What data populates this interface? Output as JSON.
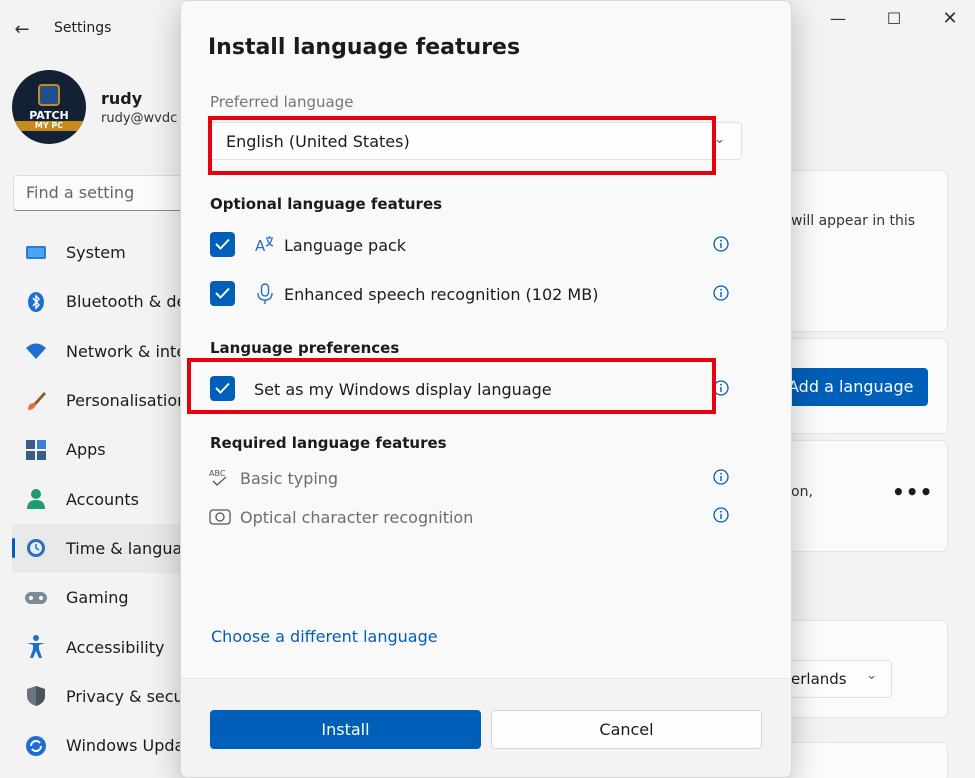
{
  "window": {
    "title": "Settings",
    "back_glyph": "←",
    "minimize_glyph": "—",
    "maximize_glyph": "☐",
    "close_glyph": "✕"
  },
  "user": {
    "name": "rudy",
    "email": "rudy@wvdc",
    "avatar_text_top": "PATCH",
    "avatar_text_bottom": "MY PC"
  },
  "search": {
    "placeholder": "Find a setting"
  },
  "sidebar": {
    "items": [
      {
        "label": "System",
        "icon": "monitor-icon"
      },
      {
        "label": "Bluetooth & de",
        "icon": "bluetooth-icon"
      },
      {
        "label": "Network & inte",
        "icon": "wifi-icon"
      },
      {
        "label": "Personalisation",
        "icon": "brush-icon"
      },
      {
        "label": "Apps",
        "icon": "apps-icon"
      },
      {
        "label": "Accounts",
        "icon": "person-icon"
      },
      {
        "label": "Time & langua",
        "icon": "clock-globe-icon",
        "active": true
      },
      {
        "label": "Gaming",
        "icon": "gamepad-icon"
      },
      {
        "label": "Accessibility",
        "icon": "accessibility-icon"
      },
      {
        "label": "Privacy & secu",
        "icon": "shield-icon"
      },
      {
        "label": "Windows Upda",
        "icon": "update-icon"
      }
    ]
  },
  "background": {
    "info_text": "will appear in this",
    "add_language_label": "Add a language",
    "partial_text": "on,",
    "more_glyph": "•••",
    "region_value": "erlands",
    "region_chevron": "⌄"
  },
  "dialog": {
    "title": "Install language features",
    "preferred_label": "Preferred language",
    "preferred_value": "English (United States)",
    "select_chevron": "⌄",
    "optional_heading": "Optional language features",
    "optional_features": [
      {
        "label": "Language pack",
        "checked": true,
        "icon": "language-pack-icon"
      },
      {
        "label": "Enhanced speech recognition (102 MB)",
        "checked": true,
        "icon": "microphone-icon"
      }
    ],
    "preferences_heading": "Language preferences",
    "display_language_label": "Set as my Windows display language",
    "display_language_checked": true,
    "required_heading": "Required language features",
    "required_features": [
      {
        "label": "Basic typing",
        "icon": "abc-check-icon",
        "icon_text": "ABC"
      },
      {
        "label": "Optical character recognition",
        "icon": "camera-ocr-icon"
      }
    ],
    "choose_link": "Choose a different language",
    "install_label": "Install",
    "cancel_label": "Cancel"
  },
  "colors": {
    "accent": "#005fb8",
    "highlight": "#e8000e",
    "background": "#f3f3f3"
  }
}
